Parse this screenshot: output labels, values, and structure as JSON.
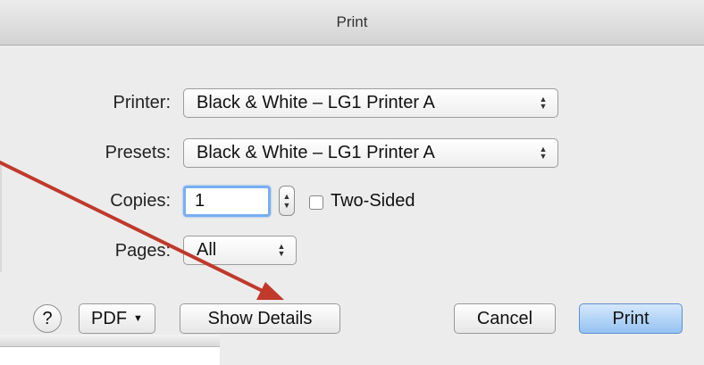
{
  "window": {
    "title": "Print"
  },
  "form": {
    "printer": {
      "label": "Printer:",
      "value": "Black & White – LG1 Printer A"
    },
    "presets": {
      "label": "Presets:",
      "value": "Black & White – LG1 Printer A"
    },
    "copies": {
      "label": "Copies:",
      "value": "1"
    },
    "two_sided": {
      "label": "Two-Sided",
      "checked": false
    },
    "pages": {
      "label": "Pages:",
      "value": "All"
    }
  },
  "buttons": {
    "help": "?",
    "pdf": "PDF",
    "show_details": "Show Details",
    "cancel": "Cancel",
    "print": "Print"
  },
  "annotation": {
    "arrow_color": "#c0392b"
  }
}
